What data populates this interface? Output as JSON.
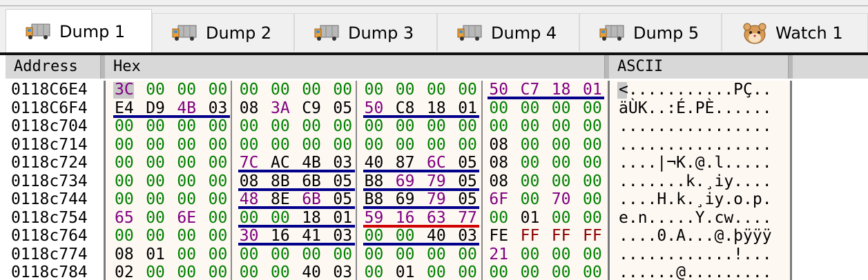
{
  "tabs": [
    {
      "label": "Dump 1",
      "icon": "truck-icon",
      "active": true
    },
    {
      "label": "Dump 2",
      "icon": "truck-icon",
      "active": false
    },
    {
      "label": "Dump 3",
      "icon": "truck-icon",
      "active": false
    },
    {
      "label": "Dump 4",
      "icon": "truck-icon",
      "active": false
    },
    {
      "label": "Dump 5",
      "icon": "truck-icon",
      "active": false
    },
    {
      "label": "Watch 1",
      "icon": "hamster-icon",
      "active": false
    }
  ],
  "columns": {
    "address": "Address",
    "hex": "Hex",
    "ascii": "ASCII"
  },
  "colors": {
    "zero": "#008000",
    "text": "#000000",
    "pointer": "#800080",
    "ff": "#8b0000",
    "underline_blue": "#00008b",
    "underline_red": "#d00000"
  },
  "rows": [
    {
      "address": "0118C6E4",
      "bytes": [
        "3C",
        "00",
        "00",
        "00",
        "00",
        "00",
        "00",
        "00",
        "00",
        "00",
        "00",
        "00",
        "50",
        "C7",
        "18",
        "01"
      ],
      "ascii": "<...........PÇ.."
    },
    {
      "address": "0118C6F4",
      "bytes": [
        "E4",
        "D9",
        "4B",
        "03",
        "08",
        "3A",
        "C9",
        "05",
        "50",
        "C8",
        "18",
        "01",
        "00",
        "00",
        "00",
        "00"
      ],
      "ascii": "äÙK..:É.PÈ......"
    },
    {
      "address": "0118c704",
      "bytes": [
        "00",
        "00",
        "00",
        "00",
        "00",
        "00",
        "00",
        "00",
        "00",
        "00",
        "00",
        "00",
        "00",
        "00",
        "00",
        "00"
      ],
      "ascii": "................"
    },
    {
      "address": "0118c714",
      "bytes": [
        "00",
        "00",
        "00",
        "00",
        "00",
        "00",
        "00",
        "00",
        "00",
        "00",
        "00",
        "00",
        "08",
        "00",
        "00",
        "00"
      ],
      "ascii": "................"
    },
    {
      "address": "0118c724",
      "bytes": [
        "00",
        "00",
        "00",
        "00",
        "7C",
        "AC",
        "4B",
        "03",
        "40",
        "87",
        "6C",
        "05",
        "08",
        "00",
        "00",
        "00"
      ],
      "ascii": "....|¬K.@.l....."
    },
    {
      "address": "0118c734",
      "bytes": [
        "00",
        "00",
        "00",
        "00",
        "08",
        "8B",
        "6B",
        "05",
        "B8",
        "69",
        "79",
        "05",
        "08",
        "00",
        "00",
        "00"
      ],
      "ascii": ".......k.¸iy...."
    },
    {
      "address": "0118c744",
      "bytes": [
        "00",
        "00",
        "00",
        "00",
        "48",
        "8E",
        "6B",
        "05",
        "B8",
        "69",
        "79",
        "05",
        "6F",
        "00",
        "70",
        "00"
      ],
      "ascii": "....H.k.¸iy.o.p."
    },
    {
      "address": "0118c754",
      "bytes": [
        "65",
        "00",
        "6E",
        "00",
        "00",
        "00",
        "18",
        "01",
        "59",
        "16",
        "63",
        "77",
        "00",
        "01",
        "00",
        "00"
      ],
      "ascii": "e.n.....Y.cw...."
    },
    {
      "address": "0118c764",
      "bytes": [
        "00",
        "00",
        "00",
        "00",
        "30",
        "16",
        "41",
        "03",
        "00",
        "00",
        "40",
        "03",
        "FE",
        "FF",
        "FF",
        "FF"
      ],
      "ascii": "....0.A...@.þÿÿÿ"
    },
    {
      "address": "0118c774",
      "bytes": [
        "08",
        "01",
        "00",
        "00",
        "00",
        "00",
        "00",
        "00",
        "00",
        "00",
        "00",
        "00",
        "21",
        "00",
        "00",
        "00"
      ],
      "ascii": "............!..."
    },
    {
      "address": "0118c784",
      "bytes": [
        "02",
        "00",
        "00",
        "00",
        "00",
        "00",
        "40",
        "03",
        "00",
        "01",
        "00",
        "00",
        "00",
        "00",
        "00",
        "00"
      ],
      "ascii": "......@........."
    }
  ],
  "underlines": [
    {
      "row": 0,
      "group": 3,
      "color": "blue"
    },
    {
      "row": 1,
      "group": 0,
      "color": "blue"
    },
    {
      "row": 1,
      "group": 2,
      "color": "blue"
    },
    {
      "row": 4,
      "group": 1,
      "color": "blue"
    },
    {
      "row": 4,
      "group": 2,
      "color": "blue"
    },
    {
      "row": 5,
      "group": 1,
      "color": "blue"
    },
    {
      "row": 5,
      "group": 2,
      "color": "blue"
    },
    {
      "row": 6,
      "group": 1,
      "color": "blue"
    },
    {
      "row": 6,
      "group": 2,
      "color": "blue"
    },
    {
      "row": 7,
      "group": 1,
      "color": "blue"
    },
    {
      "row": 7,
      "group": 2,
      "color": "red"
    },
    {
      "row": 8,
      "group": 1,
      "color": "blue"
    },
    {
      "row": 8,
      "group": 2,
      "color": "blue"
    }
  ],
  "selection": {
    "row": 0,
    "byte": 0
  }
}
